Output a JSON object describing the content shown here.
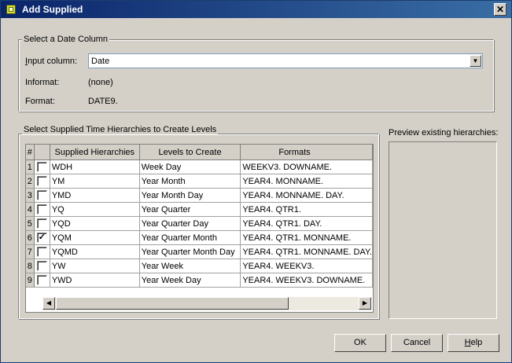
{
  "window": {
    "title": "Add Supplied",
    "close_glyph": "✕"
  },
  "date_group": {
    "label": "Select a Date Column",
    "input_label": "Input column:",
    "input_value": "Date",
    "informat_label": "Informat:",
    "informat_value": "(none)",
    "format_label": "Format:",
    "format_value": "DATE9."
  },
  "hier_group": {
    "label": "Select Supplied Time Hierarchies to Create Levels",
    "columns": [
      "#",
      "",
      "Supplied Hierarchies",
      "Levels to Create",
      "Formats"
    ],
    "rows": [
      {
        "num": "1",
        "checked": false,
        "hierarchy": "WDH",
        "levels": "Week Day",
        "formats": "WEEKV3. DOWNAME."
      },
      {
        "num": "2",
        "checked": false,
        "hierarchy": "YM",
        "levels": "Year Month",
        "formats": "YEAR4. MONNAME."
      },
      {
        "num": "3",
        "checked": false,
        "hierarchy": "YMD",
        "levels": "Year Month Day",
        "formats": "YEAR4. MONNAME. DAY."
      },
      {
        "num": "4",
        "checked": false,
        "hierarchy": "YQ",
        "levels": "Year Quarter",
        "formats": "YEAR4. QTR1."
      },
      {
        "num": "5",
        "checked": false,
        "hierarchy": "YQD",
        "levels": "Year Quarter Day",
        "formats": "YEAR4. QTR1. DAY."
      },
      {
        "num": "6",
        "checked": true,
        "hierarchy": "YQM",
        "levels": "Year Quarter Month",
        "formats": "YEAR4. QTR1. MONNAME."
      },
      {
        "num": "7",
        "checked": false,
        "hierarchy": "YQMD",
        "levels": "Year Quarter Month Day",
        "formats": "YEAR4. QTR1. MONNAME. DAY."
      },
      {
        "num": "8",
        "checked": false,
        "hierarchy": "YW",
        "levels": "Year Week",
        "formats": "YEAR4. WEEKV3."
      },
      {
        "num": "9",
        "checked": false,
        "hierarchy": "YWD",
        "levels": "Year Week Day",
        "formats": "YEAR4. WEEKV3. DOWNAME."
      }
    ]
  },
  "preview": {
    "label": "Preview existing hierarchies:"
  },
  "scroll": {
    "left_glyph": "◀",
    "right_glyph": "▶",
    "combo_glyph": "▼"
  },
  "buttons": {
    "ok": "OK",
    "cancel": "Cancel",
    "help": "Help"
  }
}
